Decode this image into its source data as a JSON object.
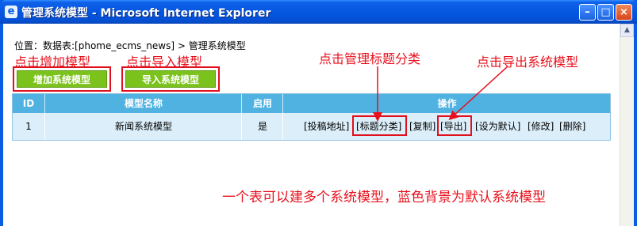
{
  "window": {
    "title": "管理系统模型 - Microsoft Internet Explorer",
    "minimize": "–",
    "maximize": "□",
    "close": "×"
  },
  "breadcrumb": {
    "prefix": "位置：",
    "table_link": "数据表:[phome_ecms_news]",
    "separator": " > ",
    "page_link": "管理系统模型"
  },
  "annotations": {
    "add_model": "点击增加模型",
    "import_model": "点击导入模型",
    "manage_title_category": "点击管理标题分类",
    "export_model": "点击导出系统模型",
    "footer": "一个表可以建多个系统模型，蓝色背景为默认系统模型"
  },
  "buttons": {
    "add_model": "增加系统模型",
    "import_model": "导入系统模型"
  },
  "table": {
    "columns": [
      "ID",
      "模型名称",
      "启用",
      "操作"
    ],
    "rows": [
      {
        "id": "1",
        "name": "新闻系统模型",
        "enabled": "是",
        "actions": [
          "[投稿地址]",
          "[标题分类]",
          "[复制]",
          "[导出]",
          "[设为默认]",
          "[修改]",
          "[删除]"
        ]
      }
    ]
  },
  "colors": {
    "annotation": "#e8101c",
    "button_green": "#7cc21d",
    "header_blue": "#4fb2e0",
    "default_row_bg": "#dbeef9"
  }
}
